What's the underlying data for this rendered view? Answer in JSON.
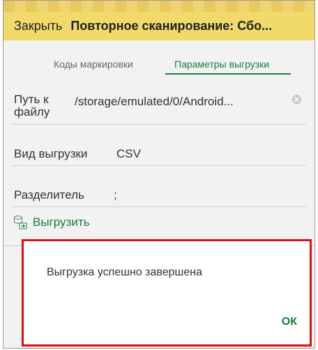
{
  "window": {
    "close_label": "Закрыть",
    "title": "Повторное сканирование: Сбо..."
  },
  "tabs": [
    {
      "label": "Коды маркировки",
      "active": false
    },
    {
      "label": "Параметры выгрузки",
      "active": true
    }
  ],
  "form": {
    "file_path": {
      "label": "Путь к файлу",
      "value": "/storage/emulated/0/Android...",
      "clear_icon": "clear-circle-icon"
    },
    "export_type": {
      "label": "Вид выгрузки",
      "value": "CSV"
    },
    "separator": {
      "label": "Разделитель",
      "value": ";"
    }
  },
  "actions": {
    "export_label": "Выгрузить",
    "export_icon": "export-database-icon"
  },
  "dialog": {
    "message": "Выгрузка успешно завершена",
    "ok_label": "ОК"
  },
  "colors": {
    "header_bg": "#f1da69",
    "accent": "#1f7a3a",
    "highlight_border": "#e01010"
  }
}
